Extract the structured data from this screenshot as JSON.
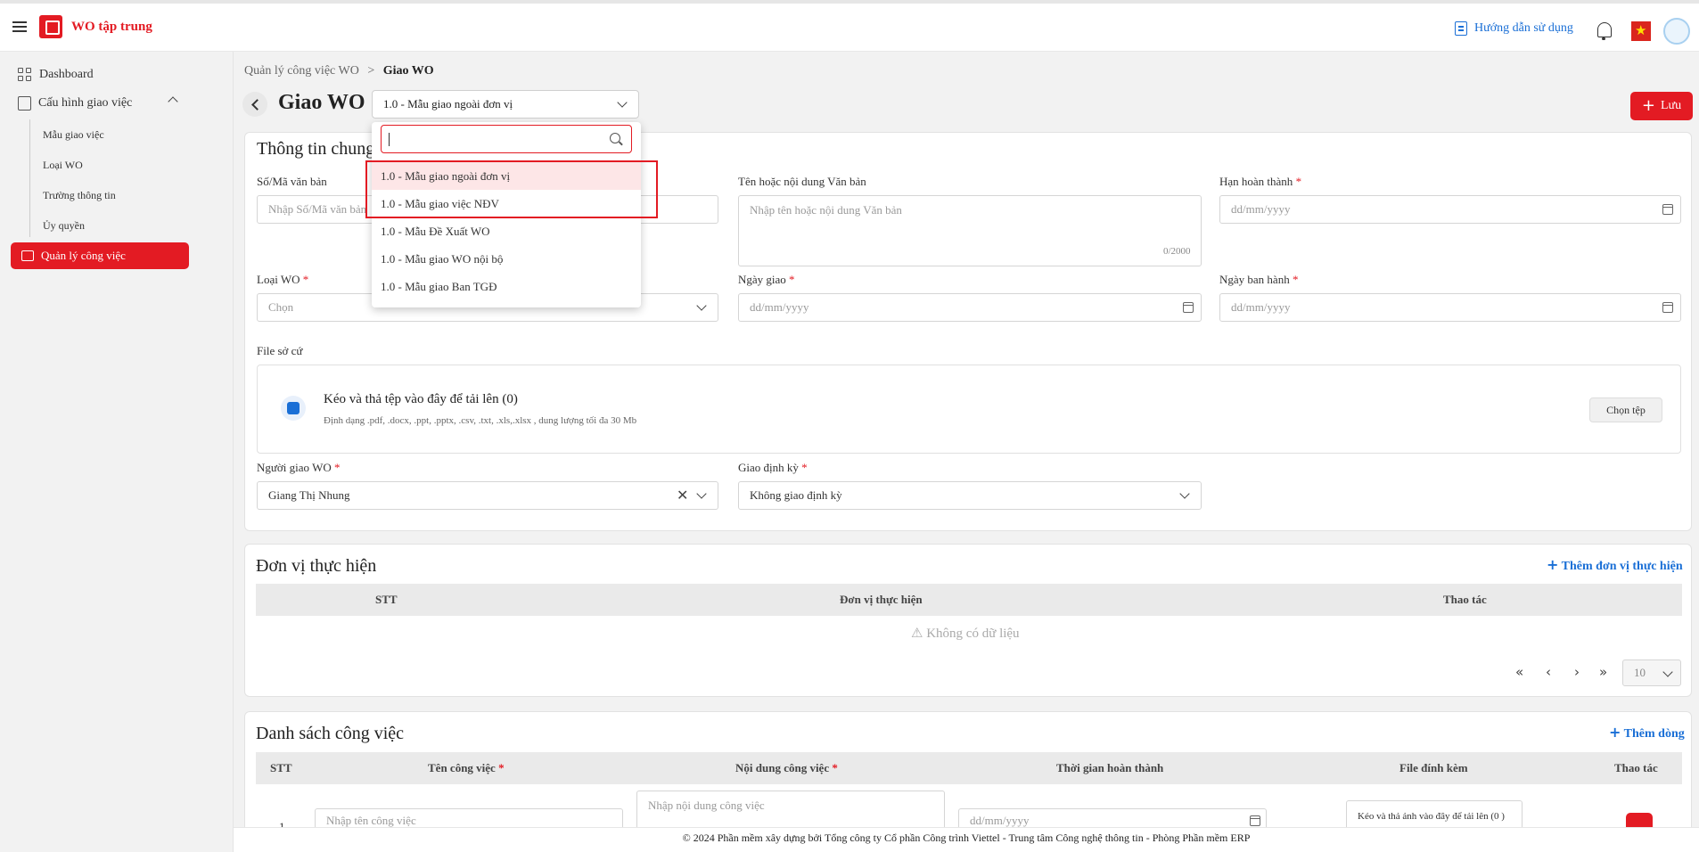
{
  "header": {
    "app_title": "WO tập trung",
    "guide_label": "Hướng dẫn sử dụng"
  },
  "sidebar": {
    "dashboard": "Dashboard",
    "config": "Cấu hình giao việc",
    "sub_items": [
      "Mẫu giao việc",
      "Loại WO",
      "Trường thông tin",
      "Ủy quyền"
    ],
    "active": "Quản lý công việc"
  },
  "breadcrumb": {
    "parent": "Quản lý công việc WO",
    "separator": ">",
    "current": "Giao WO"
  },
  "page": {
    "title": "Giao WO",
    "template_value": "1.0 - Mẫu giao ngoài đơn vị",
    "save_label": "Lưu"
  },
  "dropdown": {
    "search_value": "",
    "options": [
      "1.0 - Mẫu giao ngoài đơn vị",
      "1.0 - Mẫu giao việc NĐV",
      "1.0 - Mẫu Đề Xuất WO",
      "1.0 - Mẫu giao WO nội bộ",
      "1.0 - Mẫu giao Ban TGĐ"
    ]
  },
  "general": {
    "title": "Thông tin chung",
    "doc_no_label": "Số/Mã văn bản",
    "doc_no_placeholder": "Nhập Số/Mã văn bản",
    "doc_name_label": "Tên hoặc nội dung Văn bản",
    "doc_name_placeholder": "Nhập tên hoặc nội dung Văn bản",
    "doc_name_counter": "0/2000",
    "deadline_label": "Hạn hoàn thành",
    "wo_type_label": "Loại WO",
    "wo_type_placeholder": "Chọn",
    "assign_date_label": "Ngày giao",
    "issue_date_label": "Ngày ban hành",
    "date_placeholder": "dd/mm/yyyy",
    "file_label": "File sở cứ",
    "dz_title": "Kéo và thả tệp vào đây để tải lên (0)",
    "dz_sub": "Định dạng .pdf, .docx, .ppt, .pptx, .csv, .txt, .xls,.xlsx , dung lượng tối đa 30 Mb",
    "choose_file": "Chọn tệp",
    "assigner_label": "Người giao WO",
    "assigner_value": "Giang Thị Nhung",
    "periodic_label": "Giao định kỳ",
    "periodic_value": "Không giao định kỳ",
    "required_mark": "*"
  },
  "units": {
    "title": "Đơn vị thực hiện",
    "add_label": "Thêm đơn vị thực hiện",
    "columns": [
      "STT",
      "Đơn vị thực hiện",
      "Thao tác"
    ],
    "empty": "⚠ Không có dữ liệu",
    "page_size": "10"
  },
  "tasks": {
    "title": "Danh sách công việc",
    "add_label": "Thêm dòng",
    "columns": [
      "STT",
      "Tên công việc",
      "Nội dung công việc",
      "Thời gian hoàn thành",
      "File đính kèm",
      "Thao tác"
    ],
    "row_num": "1",
    "name_placeholder": "Nhập tên công việc",
    "content_placeholder": "Nhập nội dung công việc",
    "file_hint": "Kéo và thả ảnh vào đây để tải lên (0 )"
  },
  "footer": "© 2024 Phần mềm xây dựng bởi Tổng công ty Cổ phần Công trình Viettel - Trung tâm Công nghệ thông tin - Phòng Phần mềm ERP",
  "colors": {
    "brand": "#e31b23",
    "link": "#1a6fd6"
  }
}
